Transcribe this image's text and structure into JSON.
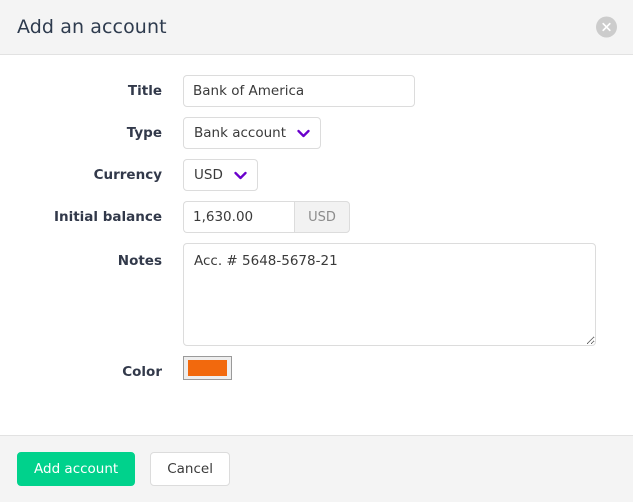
{
  "dialog": {
    "title": "Add an account",
    "close_icon": "close-circle-icon"
  },
  "form": {
    "title_field": {
      "label": "Title",
      "value": "Bank of America",
      "placeholder": ""
    },
    "type_field": {
      "label": "Type",
      "value": "Bank account",
      "chevron_icon": "chevron-down-icon",
      "options": [
        "Bank account"
      ]
    },
    "currency_field": {
      "label": "Currency",
      "value": "USD",
      "chevron_icon": "chevron-down-icon",
      "options": [
        "USD"
      ]
    },
    "initial_balance_field": {
      "label": "Initial balance",
      "value": "1,630.00",
      "placeholder": "",
      "addon": "USD"
    },
    "notes_field": {
      "label": "Notes",
      "value": "Acc. # 5648-5678-21",
      "placeholder": ""
    },
    "color_field": {
      "label": "Color",
      "value": "#f2690d"
    }
  },
  "footer": {
    "submit_label": "Add account",
    "cancel_label": "Cancel"
  },
  "colors": {
    "primary": "#00d28c",
    "header_bg": "#f4f4f4",
    "border": "#dcdcdc",
    "accent_chevron": "#6a00cc",
    "swatch": "#f2690d",
    "label_text": "#32394a"
  }
}
